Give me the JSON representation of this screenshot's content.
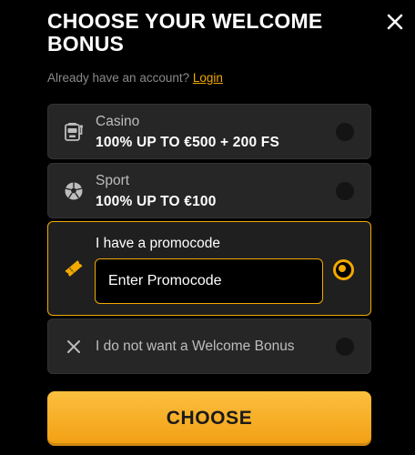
{
  "header": {
    "title": "CHOOSE YOUR WELCOME BONUS",
    "close_icon": "close-icon"
  },
  "account": {
    "question": "Already have an account?",
    "login_label": "Login"
  },
  "options": [
    {
      "id": "casino",
      "icon": "slot-machine-icon",
      "label": "Casino",
      "bonus": "100% UP TO €500 + 200 FS",
      "selected": false
    },
    {
      "id": "sport",
      "icon": "soccer-ball-icon",
      "label": "Sport",
      "bonus": "100% UP TO €100",
      "selected": false
    },
    {
      "id": "promocode",
      "icon": "ticket-icon",
      "label": "I have a promocode",
      "selected": true,
      "input": {
        "value": "",
        "placeholder": "Enter Promocode"
      }
    },
    {
      "id": "none",
      "icon": "x-icon",
      "label": "I do not want a Welcome Bonus",
      "selected": false
    }
  ],
  "choose_label": "CHOOSE",
  "colors": {
    "accent": "#f2a900",
    "background": "#000000",
    "card": "#262626"
  }
}
